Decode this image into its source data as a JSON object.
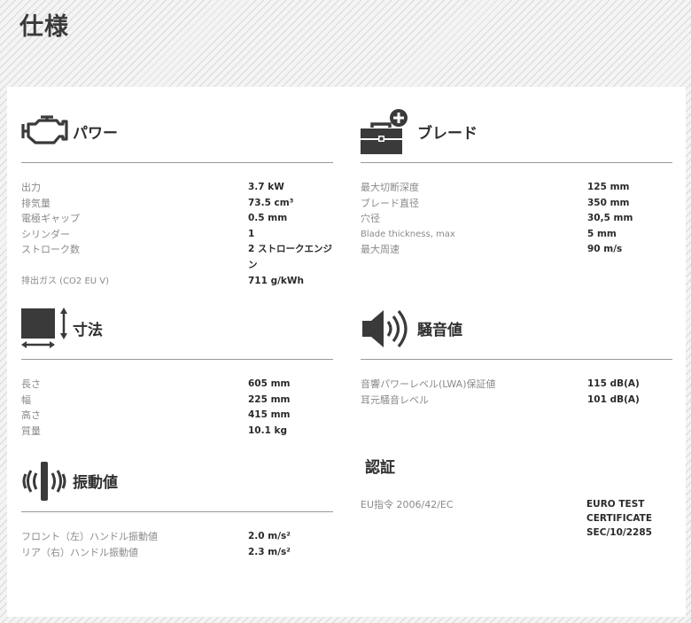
{
  "page": {
    "title": "仕様"
  },
  "sections": {
    "power": {
      "title": "パワー",
      "icon": "engine-icon",
      "rows": [
        {
          "label": "出力",
          "value": "3.7 kW"
        },
        {
          "label": "排気量",
          "value": "73.5 cm³"
        },
        {
          "label": "電極ギャップ",
          "value": "0.5 mm"
        },
        {
          "label": "シリンダー",
          "value": "1"
        },
        {
          "label": "ストローク数",
          "value": "2 ストロークエンジン"
        },
        {
          "label": "排出ガス (CO2 EU V)",
          "value": "711 g/kWh"
        }
      ]
    },
    "blade": {
      "title": "ブレード",
      "icon": "toolbox-plus-icon",
      "rows": [
        {
          "label": "最大切断深度",
          "value": "125 mm"
        },
        {
          "label": "ブレード直径",
          "value": "350 mm"
        },
        {
          "label": "穴径",
          "value": "30,5 mm"
        },
        {
          "label": "Blade thickness, max",
          "value": "5 mm"
        },
        {
          "label": "最大周速",
          "value": "90 m/s"
        }
      ]
    },
    "dimensions": {
      "title": "寸法",
      "icon": "dimensions-icon",
      "rows": [
        {
          "label": "長さ",
          "value": "605 mm"
        },
        {
          "label": "幅",
          "value": "225 mm"
        },
        {
          "label": "高さ",
          "value": "415 mm"
        },
        {
          "label": "質量",
          "value": "10.1 kg"
        }
      ]
    },
    "noise": {
      "title": "騒音値",
      "icon": "speaker-icon",
      "rows": [
        {
          "label": "音響パワーレベル(LWA)保証値",
          "value": "115 dB(A)"
        },
        {
          "label": "耳元騒音レベル",
          "value": "101 dB(A)"
        }
      ]
    },
    "vibration": {
      "title": "振動値",
      "icon": "vibration-icon",
      "rows": [
        {
          "label": "フロント（左）ハンドル振動値",
          "value": "2.0 m/s²"
        },
        {
          "label": "リア（右）ハンドル振動値",
          "value": "2.3 m/s²"
        }
      ]
    },
    "certification": {
      "title": "認証",
      "label": "EU指令 2006/42/EC",
      "value": "EURO TEST CERTIFICATE SEC/10/2285"
    }
  }
}
